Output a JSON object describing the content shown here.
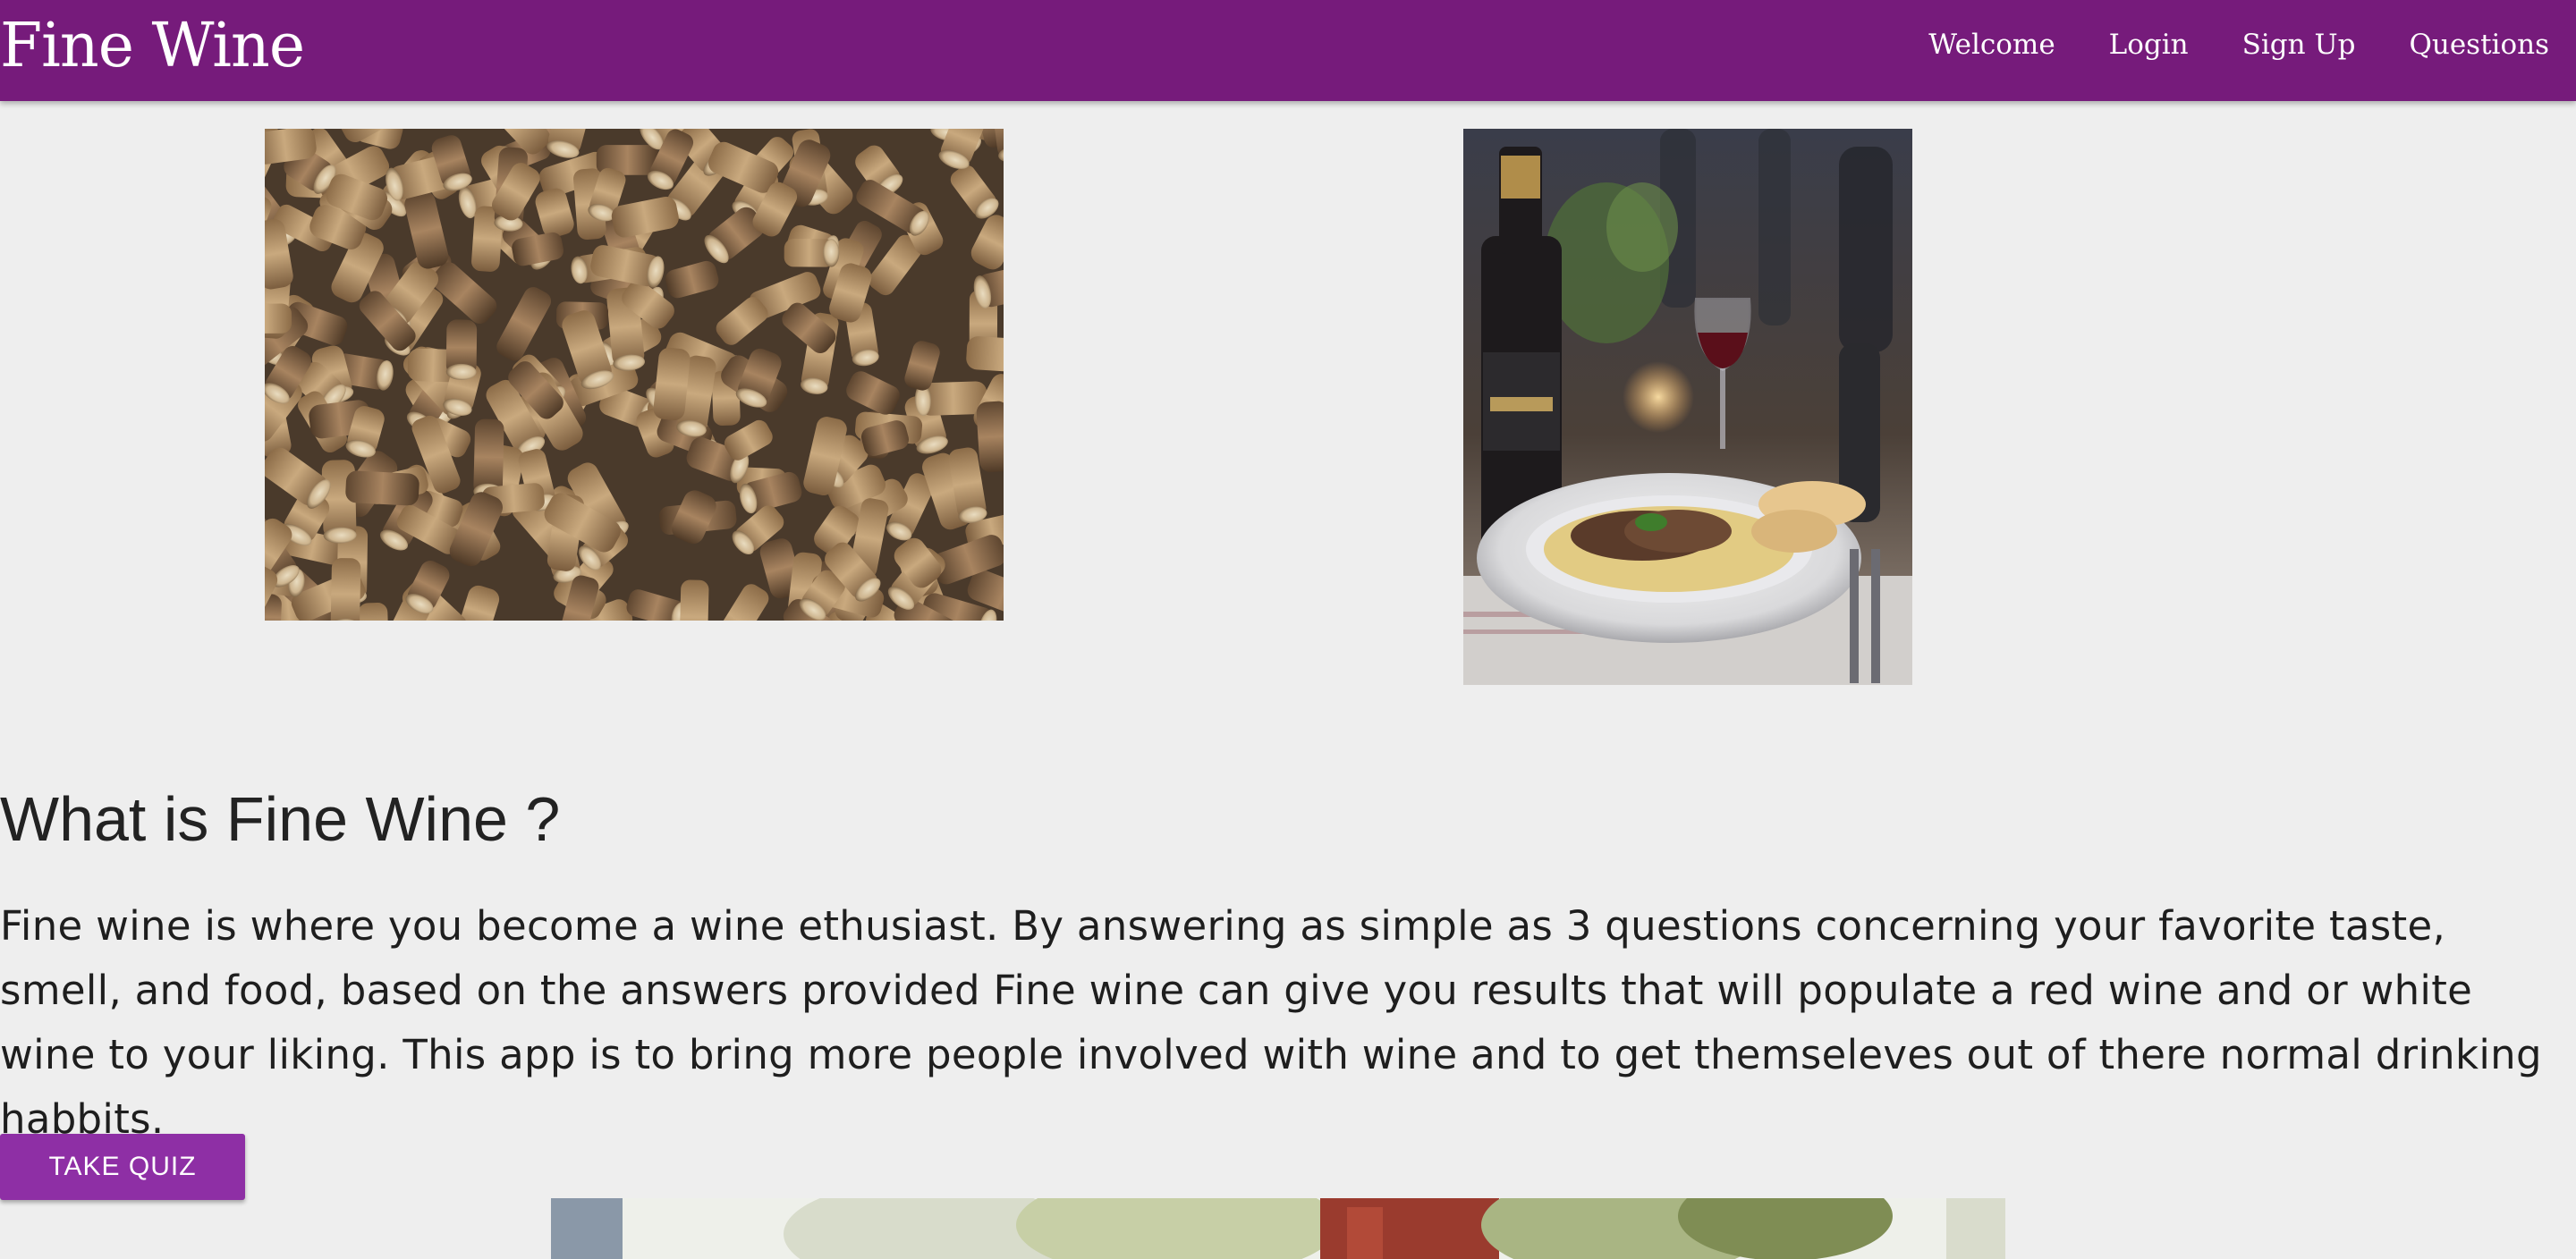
{
  "navbar": {
    "brand": "Fine Wine",
    "links": [
      {
        "label": "Welcome"
      },
      {
        "label": "Login"
      },
      {
        "label": "Sign Up"
      },
      {
        "label": "Questions"
      }
    ],
    "background_color": "#761b7b"
  },
  "images": {
    "corks": {
      "alt": "wine corks"
    },
    "dinner": {
      "alt": "pasta dinner with red wine"
    },
    "bottom": {
      "alt": "people enjoying wine outdoors"
    }
  },
  "main": {
    "title": "What is Fine Wine ?",
    "body": "Fine wine is where you become a wine ethusiast. By answering as simple as 3 questions concerning your favorite taste, smell, and food, based on the answers provided Fine wine can give you results that will populate a red wine and or white wine to your liking. This app is to bring more people involved with wine and to get themseleves out of there normal drinking habbits.",
    "quiz_button": "TAKE QUIZ",
    "button_color": "#8e2fa5"
  }
}
